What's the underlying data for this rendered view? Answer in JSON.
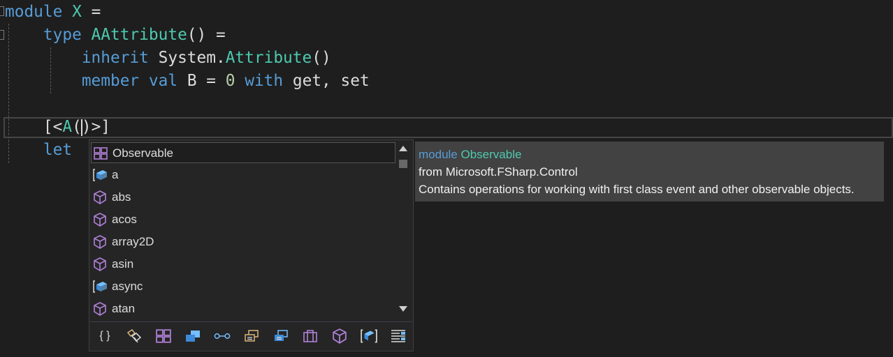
{
  "code": {
    "line1": {
      "kw": "module",
      "name": "X",
      "op": "="
    },
    "line2": {
      "kw": "type",
      "name": "AAttribute",
      "rest": "() ="
    },
    "line3": {
      "kw": "inherit",
      "ns": "System.",
      "name": "Attribute",
      "rest": "()"
    },
    "line4": {
      "kw1": "member",
      "kw2": "val",
      "name": "B",
      "eq": "=",
      "num": "0",
      "kw3": "with",
      "rest": "get, set"
    },
    "line6": {
      "open": "[<",
      "name": "A",
      "paren_open": "(",
      "paren_close": ")",
      "close": ">]"
    },
    "line7": {
      "kw": "let"
    }
  },
  "completion": {
    "items": [
      {
        "label": "Observable",
        "icon": "module-icon",
        "selected": true
      },
      {
        "label": "a",
        "icon": "snippet-icon"
      },
      {
        "label": "abs",
        "icon": "method-icon"
      },
      {
        "label": "acos",
        "icon": "method-icon"
      },
      {
        "label": "array2D",
        "icon": "method-icon"
      },
      {
        "label": "asin",
        "icon": "method-icon"
      },
      {
        "label": "async",
        "icon": "snippet-icon"
      },
      {
        "label": "atan",
        "icon": "method-icon"
      }
    ],
    "filters": [
      {
        "name": "namespace-filter-icon",
        "glyph": "{ }"
      },
      {
        "name": "property-filter-icon"
      },
      {
        "name": "module-filter-icon"
      },
      {
        "name": "class-filter-icon"
      },
      {
        "name": "interface-filter-icon"
      },
      {
        "name": "struct-filter-icon"
      },
      {
        "name": "enum-filter-icon"
      },
      {
        "name": "type-filter-icon"
      },
      {
        "name": "method-filter-icon"
      },
      {
        "name": "snippet-filter-icon"
      },
      {
        "name": "keyword-filter-icon"
      }
    ]
  },
  "tooltip": {
    "kind": "module",
    "name": "Observable",
    "from": "from Microsoft.FSharp.Control",
    "description": "Contains operations for working with first class event and other observable objects."
  },
  "colors": {
    "keyword": "#569cd6",
    "type": "#4ec9b0",
    "number": "#b5cea8",
    "icon_purple": "#b180d7",
    "icon_blue": "#75beff",
    "icon_yellow": "#dcb67a"
  }
}
